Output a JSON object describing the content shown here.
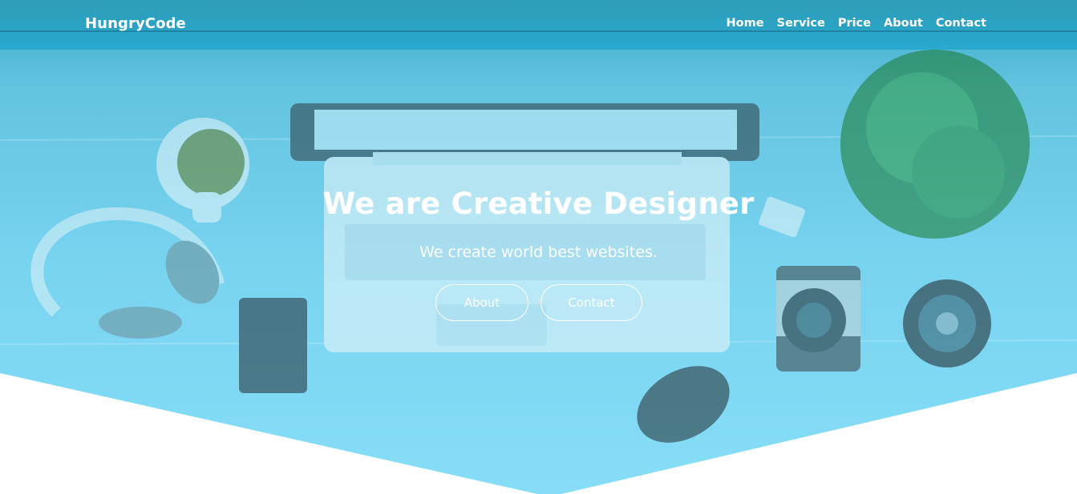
{
  "brand": {
    "name": "HungryCode"
  },
  "nav": {
    "items": [
      {
        "label": "Home"
      },
      {
        "label": "Service"
      },
      {
        "label": "Price"
      },
      {
        "label": "About"
      },
      {
        "label": "Contact"
      }
    ]
  },
  "hero": {
    "title": "We are Creative Designer",
    "subtitle": "We create world best websites.",
    "buttons": {
      "about": "About",
      "contact": "Contact"
    }
  },
  "colors": {
    "topbar": "#2aa3c5",
    "hero_tint": "#79d4f0",
    "text": "#ffffff"
  },
  "icons": [
    "laptop-icon",
    "tea-cup-icon",
    "headphones-icon",
    "smartphone-icon",
    "plant-icon",
    "camera-icon",
    "lens-icon",
    "mouse-icon",
    "eraser-icon"
  ]
}
